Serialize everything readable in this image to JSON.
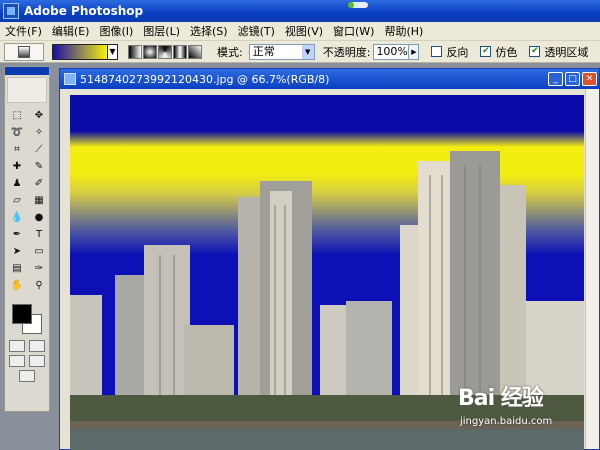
{
  "app": {
    "title": "Adobe Photoshop"
  },
  "menu": [
    "文件(F)",
    "编辑(E)",
    "图像(I)",
    "图层(L)",
    "选择(S)",
    "滤镜(T)",
    "视图(V)",
    "窗口(W)",
    "帮助(H)"
  ],
  "options": {
    "mode_label": "模式:",
    "mode_value": "正常",
    "opacity_label": "不透明度:",
    "opacity_value": "100%",
    "reverse_label": "反向",
    "dither_label": "仿色",
    "transparency_label": "透明区域",
    "reverse_checked": false,
    "dither_checked": true,
    "transparency_checked": true,
    "gradient_colors": [
      "#1a0ea8",
      "#f8f20b"
    ]
  },
  "tools": [
    "marquee-tool",
    "move-tool",
    "lasso-tool",
    "magic-wand-tool",
    "crop-tool",
    "slice-tool",
    "healing-brush-tool",
    "brush-tool",
    "clone-stamp-tool",
    "history-brush-tool",
    "eraser-tool",
    "gradient-tool",
    "blur-tool",
    "dodge-tool",
    "pen-tool",
    "type-tool",
    "path-selection-tool",
    "shape-tool",
    "notes-tool",
    "eyedropper-tool",
    "hand-tool",
    "zoom-tool"
  ],
  "document": {
    "title": "5148740273992120430.jpg @ 66.7%(RGB/8)"
  },
  "watermark": {
    "logo": "Bai 经验",
    "url": "jingyan.baidu.com"
  }
}
